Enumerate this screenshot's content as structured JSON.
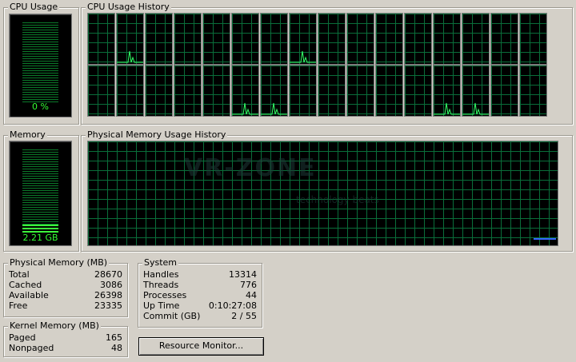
{
  "cpu_usage": {
    "title": "CPU Usage",
    "value": "0 %",
    "level": 0.0
  },
  "cpu_history": {
    "title": "CPU Usage History",
    "cores": 16,
    "spikes_top": [
      1,
      7
    ],
    "spikes_bottom": [
      5,
      6,
      12,
      13
    ]
  },
  "memory": {
    "title": "Memory",
    "value": "2.21 GB",
    "level": 0.08
  },
  "memory_history": {
    "title": "Physical Memory Usage History",
    "watermark_main": "VR-ZONE",
    "watermark_sub": "technology beats"
  },
  "physical_memory": {
    "title": "Physical Memory (MB)",
    "rows": [
      {
        "label": "Total",
        "value": "28670"
      },
      {
        "label": "Cached",
        "value": "3086"
      },
      {
        "label": "Available",
        "value": "26398"
      },
      {
        "label": "Free",
        "value": "23335"
      }
    ]
  },
  "system": {
    "title": "System",
    "rows": [
      {
        "label": "Handles",
        "value": "13314"
      },
      {
        "label": "Threads",
        "value": "776"
      },
      {
        "label": "Processes",
        "value": "44"
      },
      {
        "label": "Up Time",
        "value": "0:10:27:08"
      },
      {
        "label": "Commit (GB)",
        "value": "2 / 55"
      }
    ]
  },
  "kernel_memory": {
    "title": "Kernel Memory (MB)",
    "rows": [
      {
        "label": "Paged",
        "value": "165"
      },
      {
        "label": "Nonpaged",
        "value": "48"
      }
    ]
  },
  "resource_monitor_label": "Resource Monitor...",
  "colors": {
    "grid": "#0a6e3a",
    "meter": "#3cff3c",
    "line": "#33ff66",
    "mem_line": "#3366ff"
  }
}
